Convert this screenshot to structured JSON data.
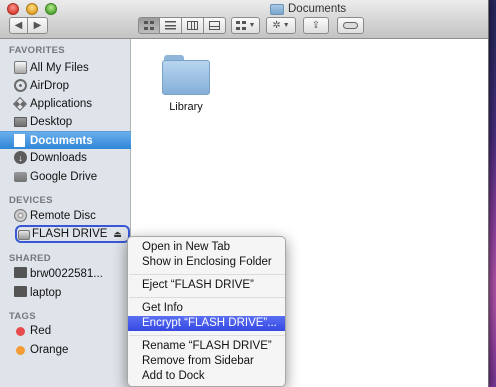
{
  "window": {
    "title": "Documents"
  },
  "toolbar": {
    "back": "◀",
    "forward": "▶"
  },
  "sidebar": {
    "favorites_header": "FAVORITES",
    "favorites": [
      {
        "label": "All My Files",
        "icon": "all-my-files-icon"
      },
      {
        "label": "AirDrop",
        "icon": "airdrop-icon"
      },
      {
        "label": "Applications",
        "icon": "applications-icon"
      },
      {
        "label": "Desktop",
        "icon": "desktop-icon"
      },
      {
        "label": "Documents",
        "icon": "documents-icon"
      },
      {
        "label": "Downloads",
        "icon": "downloads-icon"
      },
      {
        "label": "Google Drive",
        "icon": "folder-icon"
      }
    ],
    "devices_header": "DEVICES",
    "devices": [
      {
        "label": "Remote Disc",
        "icon": "disc-icon"
      },
      {
        "label": "FLASH DRIVE",
        "icon": "drive-icon"
      }
    ],
    "eject_glyph": "⏏",
    "shared_header": "SHARED",
    "shared": [
      {
        "label": "brw0022581...",
        "icon": "computer-icon"
      },
      {
        "label": "laptop",
        "icon": "computer-icon"
      }
    ],
    "tags_header": "TAGS",
    "tags": [
      {
        "label": "Red",
        "color": "#e74b4b"
      },
      {
        "label": "Orange",
        "color": "#f39c33"
      }
    ]
  },
  "main": {
    "items": [
      {
        "name": "Library"
      }
    ]
  },
  "context_menu": {
    "items": [
      "Open in New Tab",
      "Show in Enclosing Folder",
      "Eject “FLASH DRIVE”",
      "Get Info",
      "Encrypt “FLASH DRIVE”...",
      "Rename “FLASH DRIVE”",
      "Remove from Sidebar",
      "Add to Dock"
    ],
    "highlighted_index": 4
  }
}
